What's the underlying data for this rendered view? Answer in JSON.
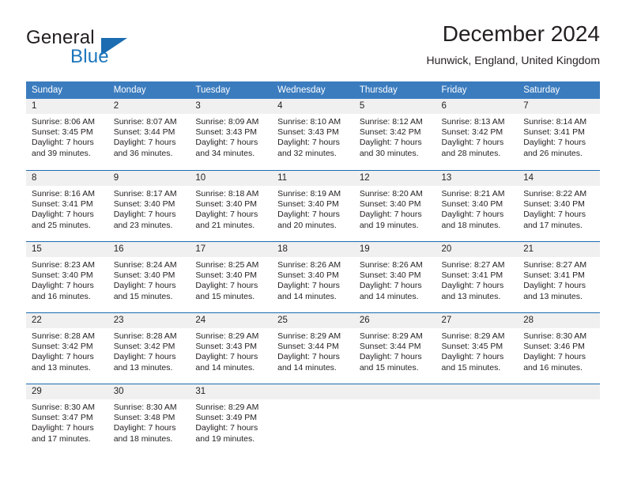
{
  "brand": {
    "word_general": "General",
    "word_blue": "Blue",
    "logo_icon": "triangle-logo-icon",
    "accent_color": "#1b6cb0"
  },
  "header": {
    "title": "December 2024",
    "subtitle": "Hunwick, England, United Kingdom"
  },
  "calendar": {
    "header_bg": "#3b7cbf",
    "daynum_bg": "#f0f0f0",
    "weekdays": [
      "Sunday",
      "Monday",
      "Tuesday",
      "Wednesday",
      "Thursday",
      "Friday",
      "Saturday"
    ],
    "weeks": [
      [
        {
          "day": "1",
          "sunrise": "Sunrise: 8:06 AM",
          "sunset": "Sunset: 3:45 PM",
          "daylight1": "Daylight: 7 hours",
          "daylight2": "and 39 minutes."
        },
        {
          "day": "2",
          "sunrise": "Sunrise: 8:07 AM",
          "sunset": "Sunset: 3:44 PM",
          "daylight1": "Daylight: 7 hours",
          "daylight2": "and 36 minutes."
        },
        {
          "day": "3",
          "sunrise": "Sunrise: 8:09 AM",
          "sunset": "Sunset: 3:43 PM",
          "daylight1": "Daylight: 7 hours",
          "daylight2": "and 34 minutes."
        },
        {
          "day": "4",
          "sunrise": "Sunrise: 8:10 AM",
          "sunset": "Sunset: 3:43 PM",
          "daylight1": "Daylight: 7 hours",
          "daylight2": "and 32 minutes."
        },
        {
          "day": "5",
          "sunrise": "Sunrise: 8:12 AM",
          "sunset": "Sunset: 3:42 PM",
          "daylight1": "Daylight: 7 hours",
          "daylight2": "and 30 minutes."
        },
        {
          "day": "6",
          "sunrise": "Sunrise: 8:13 AM",
          "sunset": "Sunset: 3:42 PM",
          "daylight1": "Daylight: 7 hours",
          "daylight2": "and 28 minutes."
        },
        {
          "day": "7",
          "sunrise": "Sunrise: 8:14 AM",
          "sunset": "Sunset: 3:41 PM",
          "daylight1": "Daylight: 7 hours",
          "daylight2": "and 26 minutes."
        }
      ],
      [
        {
          "day": "8",
          "sunrise": "Sunrise: 8:16 AM",
          "sunset": "Sunset: 3:41 PM",
          "daylight1": "Daylight: 7 hours",
          "daylight2": "and 25 minutes."
        },
        {
          "day": "9",
          "sunrise": "Sunrise: 8:17 AM",
          "sunset": "Sunset: 3:40 PM",
          "daylight1": "Daylight: 7 hours",
          "daylight2": "and 23 minutes."
        },
        {
          "day": "10",
          "sunrise": "Sunrise: 8:18 AM",
          "sunset": "Sunset: 3:40 PM",
          "daylight1": "Daylight: 7 hours",
          "daylight2": "and 21 minutes."
        },
        {
          "day": "11",
          "sunrise": "Sunrise: 8:19 AM",
          "sunset": "Sunset: 3:40 PM",
          "daylight1": "Daylight: 7 hours",
          "daylight2": "and 20 minutes."
        },
        {
          "day": "12",
          "sunrise": "Sunrise: 8:20 AM",
          "sunset": "Sunset: 3:40 PM",
          "daylight1": "Daylight: 7 hours",
          "daylight2": "and 19 minutes."
        },
        {
          "day": "13",
          "sunrise": "Sunrise: 8:21 AM",
          "sunset": "Sunset: 3:40 PM",
          "daylight1": "Daylight: 7 hours",
          "daylight2": "and 18 minutes."
        },
        {
          "day": "14",
          "sunrise": "Sunrise: 8:22 AM",
          "sunset": "Sunset: 3:40 PM",
          "daylight1": "Daylight: 7 hours",
          "daylight2": "and 17 minutes."
        }
      ],
      [
        {
          "day": "15",
          "sunrise": "Sunrise: 8:23 AM",
          "sunset": "Sunset: 3:40 PM",
          "daylight1": "Daylight: 7 hours",
          "daylight2": "and 16 minutes."
        },
        {
          "day": "16",
          "sunrise": "Sunrise: 8:24 AM",
          "sunset": "Sunset: 3:40 PM",
          "daylight1": "Daylight: 7 hours",
          "daylight2": "and 15 minutes."
        },
        {
          "day": "17",
          "sunrise": "Sunrise: 8:25 AM",
          "sunset": "Sunset: 3:40 PM",
          "daylight1": "Daylight: 7 hours",
          "daylight2": "and 15 minutes."
        },
        {
          "day": "18",
          "sunrise": "Sunrise: 8:26 AM",
          "sunset": "Sunset: 3:40 PM",
          "daylight1": "Daylight: 7 hours",
          "daylight2": "and 14 minutes."
        },
        {
          "day": "19",
          "sunrise": "Sunrise: 8:26 AM",
          "sunset": "Sunset: 3:40 PM",
          "daylight1": "Daylight: 7 hours",
          "daylight2": "and 14 minutes."
        },
        {
          "day": "20",
          "sunrise": "Sunrise: 8:27 AM",
          "sunset": "Sunset: 3:41 PM",
          "daylight1": "Daylight: 7 hours",
          "daylight2": "and 13 minutes."
        },
        {
          "day": "21",
          "sunrise": "Sunrise: 8:27 AM",
          "sunset": "Sunset: 3:41 PM",
          "daylight1": "Daylight: 7 hours",
          "daylight2": "and 13 minutes."
        }
      ],
      [
        {
          "day": "22",
          "sunrise": "Sunrise: 8:28 AM",
          "sunset": "Sunset: 3:42 PM",
          "daylight1": "Daylight: 7 hours",
          "daylight2": "and 13 minutes."
        },
        {
          "day": "23",
          "sunrise": "Sunrise: 8:28 AM",
          "sunset": "Sunset: 3:42 PM",
          "daylight1": "Daylight: 7 hours",
          "daylight2": "and 13 minutes."
        },
        {
          "day": "24",
          "sunrise": "Sunrise: 8:29 AM",
          "sunset": "Sunset: 3:43 PM",
          "daylight1": "Daylight: 7 hours",
          "daylight2": "and 14 minutes."
        },
        {
          "day": "25",
          "sunrise": "Sunrise: 8:29 AM",
          "sunset": "Sunset: 3:44 PM",
          "daylight1": "Daylight: 7 hours",
          "daylight2": "and 14 minutes."
        },
        {
          "day": "26",
          "sunrise": "Sunrise: 8:29 AM",
          "sunset": "Sunset: 3:44 PM",
          "daylight1": "Daylight: 7 hours",
          "daylight2": "and 15 minutes."
        },
        {
          "day": "27",
          "sunrise": "Sunrise: 8:29 AM",
          "sunset": "Sunset: 3:45 PM",
          "daylight1": "Daylight: 7 hours",
          "daylight2": "and 15 minutes."
        },
        {
          "day": "28",
          "sunrise": "Sunrise: 8:30 AM",
          "sunset": "Sunset: 3:46 PM",
          "daylight1": "Daylight: 7 hours",
          "daylight2": "and 16 minutes."
        }
      ],
      [
        {
          "day": "29",
          "sunrise": "Sunrise: 8:30 AM",
          "sunset": "Sunset: 3:47 PM",
          "daylight1": "Daylight: 7 hours",
          "daylight2": "and 17 minutes."
        },
        {
          "day": "30",
          "sunrise": "Sunrise: 8:30 AM",
          "sunset": "Sunset: 3:48 PM",
          "daylight1": "Daylight: 7 hours",
          "daylight2": "and 18 minutes."
        },
        {
          "day": "31",
          "sunrise": "Sunrise: 8:29 AM",
          "sunset": "Sunset: 3:49 PM",
          "daylight1": "Daylight: 7 hours",
          "daylight2": "and 19 minutes."
        },
        {
          "day": "",
          "sunrise": "",
          "sunset": "",
          "daylight1": "",
          "daylight2": ""
        },
        {
          "day": "",
          "sunrise": "",
          "sunset": "",
          "daylight1": "",
          "daylight2": ""
        },
        {
          "day": "",
          "sunrise": "",
          "sunset": "",
          "daylight1": "",
          "daylight2": ""
        },
        {
          "day": "",
          "sunrise": "",
          "sunset": "",
          "daylight1": "",
          "daylight2": ""
        }
      ]
    ]
  }
}
